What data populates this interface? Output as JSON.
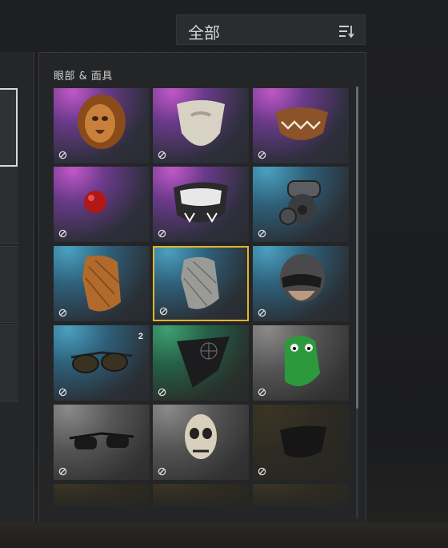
{
  "filter": {
    "label": "全部",
    "icon": "sort-icon"
  },
  "category": {
    "title": "眼部 & 面具"
  },
  "items": [
    {
      "name": "lion-mask",
      "bg": "purple",
      "locked": true
    },
    {
      "name": "beard-mask",
      "bg": "purple",
      "locked": true
    },
    {
      "name": "fanged-mouth-mask",
      "bg": "purple",
      "locked": true
    },
    {
      "name": "red-clown-nose",
      "bg": "purple",
      "locked": true
    },
    {
      "name": "tiger-face-mask",
      "bg": "purple",
      "locked": true
    },
    {
      "name": "gas-mask",
      "bg": "teal",
      "locked": true
    },
    {
      "name": "orange-neck-gaiter",
      "bg": "teal",
      "locked": true
    },
    {
      "name": "grey-neck-gaiter",
      "bg": "teal",
      "locked": true,
      "selected": true
    },
    {
      "name": "skull-helmet-mask",
      "bg": "teal",
      "locked": true
    },
    {
      "name": "aviator-sunglasses",
      "bg": "teal",
      "locked": true,
      "count": "2"
    },
    {
      "name": "web-bandana",
      "bg": "green",
      "locked": true
    },
    {
      "name": "green-dino-mask",
      "bg": "grey",
      "locked": true
    },
    {
      "name": "black-sunglasses",
      "bg": "grey",
      "locked": true
    },
    {
      "name": "skull-mask",
      "bg": "grey",
      "locked": true
    },
    {
      "name": "black-face-mask",
      "bg": "olive",
      "locked": true
    }
  ]
}
